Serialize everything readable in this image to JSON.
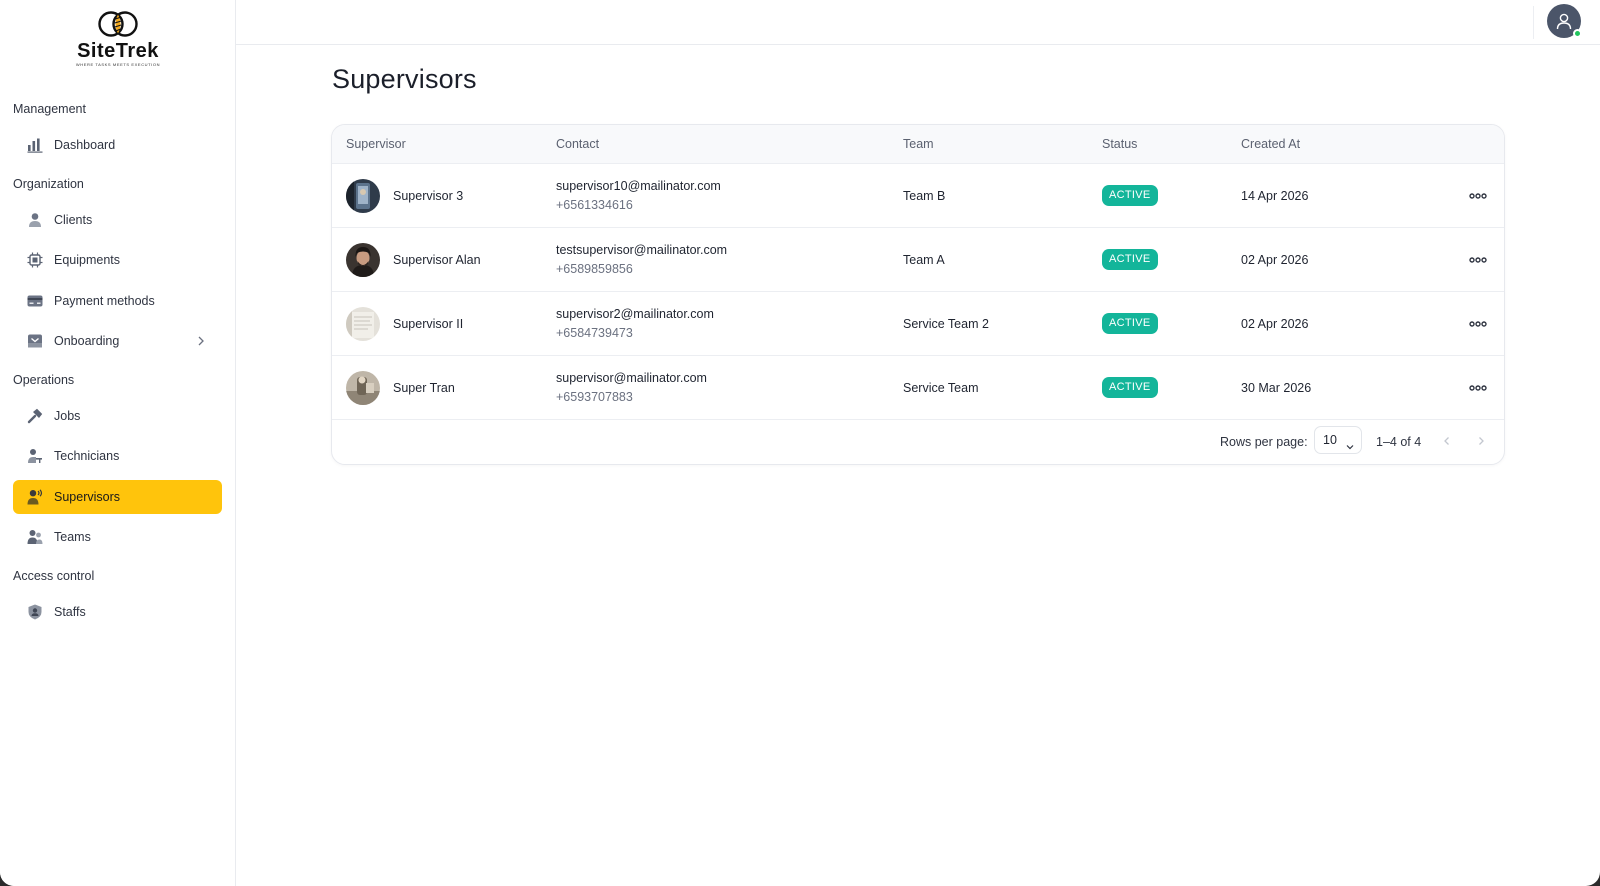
{
  "app": {
    "name": "SiteTrek",
    "tagline": "WHERE TASKS MEETS EXECUTION"
  },
  "sidebar": {
    "sections": [
      {
        "label": "Management",
        "items": [
          {
            "label": "Dashboard",
            "icon": "bar-chart-icon"
          }
        ]
      },
      {
        "label": "Organization",
        "items": [
          {
            "label": "Clients",
            "icon": "person-icon"
          },
          {
            "label": "Equipments",
            "icon": "chip-icon"
          },
          {
            "label": "Payment methods",
            "icon": "card-icon"
          },
          {
            "label": "Onboarding",
            "icon": "inbox-icon",
            "expandable": true
          }
        ]
      },
      {
        "label": "Operations",
        "items": [
          {
            "label": "Jobs",
            "icon": "hammer-icon"
          },
          {
            "label": "Technicians",
            "icon": "technician-icon"
          },
          {
            "label": "Supervisors",
            "icon": "supervisor-icon",
            "active": true
          },
          {
            "label": "Teams",
            "icon": "team-icon"
          }
        ]
      },
      {
        "label": "Access control",
        "items": [
          {
            "label": "Staffs",
            "icon": "shield-user-icon"
          }
        ]
      }
    ]
  },
  "page": {
    "title": "Supervisors"
  },
  "table": {
    "columns": [
      "Supervisor",
      "Contact",
      "Team",
      "Status",
      "Created At"
    ],
    "rows": [
      {
        "name": "Supervisor 3",
        "email": "supervisor10@mailinator.com",
        "phone": "+6561334616",
        "team": "Team B",
        "status": "ACTIVE",
        "created": "14 Apr 2026"
      },
      {
        "name": "Supervisor Alan",
        "email": "testsupervisor@mailinator.com",
        "phone": "+6589859856",
        "team": "Team A",
        "status": "ACTIVE",
        "created": "02 Apr 2026"
      },
      {
        "name": "Supervisor II",
        "email": "supervisor2@mailinator.com",
        "phone": "+6584739473",
        "team": "Service Team 2",
        "status": "ACTIVE",
        "created": "02 Apr 2026"
      },
      {
        "name": "Super Tran",
        "email": "supervisor@mailinator.com",
        "phone": "+6593707883",
        "team": "Service Team",
        "status": "ACTIVE",
        "created": "30 Mar 2026"
      }
    ],
    "pagination": {
      "rows_per_page_label": "Rows per page:",
      "rows_per_page": "10",
      "range": "1–4 of 4"
    }
  },
  "colors": {
    "accent": "#ffc40c",
    "status_active": "#13b59a",
    "online": "#22c55e"
  }
}
